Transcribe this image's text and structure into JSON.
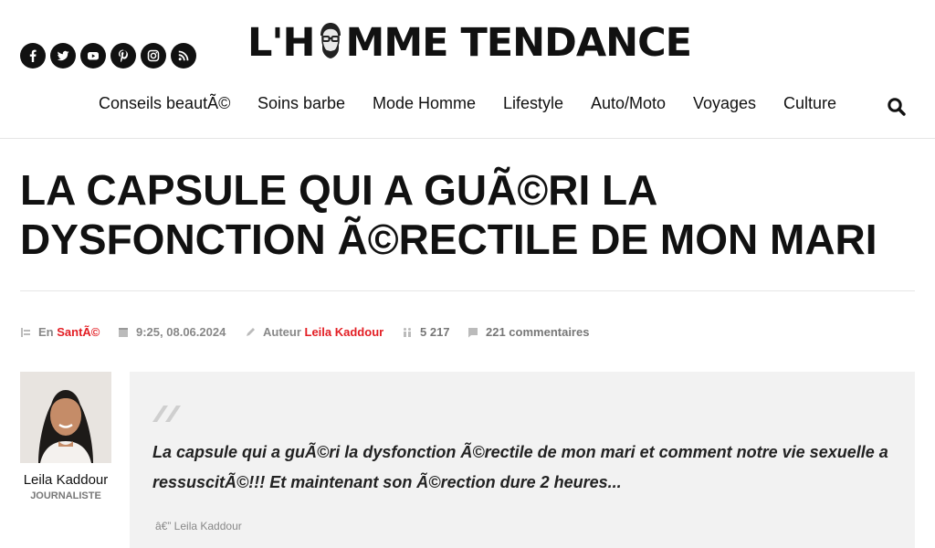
{
  "header": {
    "logo_text": "L'HOMME TENDANCE",
    "logo_left": "L'H",
    "logo_right": "MME TENDANCE"
  },
  "social": [
    {
      "icon": "facebook-icon"
    },
    {
      "icon": "twitter-icon"
    },
    {
      "icon": "youtube-icon"
    },
    {
      "icon": "pinterest-icon"
    },
    {
      "icon": "instagram-icon"
    },
    {
      "icon": "rss-icon"
    }
  ],
  "nav": {
    "items": [
      {
        "label": "Conseils beautÃ©"
      },
      {
        "label": "Soins barbe"
      },
      {
        "label": "Mode Homme"
      },
      {
        "label": "Lifestyle"
      },
      {
        "label": "Auto/Moto"
      },
      {
        "label": "Voyages"
      },
      {
        "label": "Culture"
      }
    ],
    "search_icon": "search-icon"
  },
  "article": {
    "title": "LA CAPSULE QUI A GUÃ©RI LA DYSFONCTION Ã©RECTILE DE MON MARI",
    "meta": {
      "category_prefix": "En",
      "category": "SantÃ©",
      "datetime": "9:25, 08.06.2024",
      "author_prefix": "Auteur",
      "author": "Leila Kaddour",
      "views": "5 217",
      "comments": "221 commentaires"
    }
  },
  "author_box": {
    "name": "Leila Kaddour",
    "role": "JOURNALISTE"
  },
  "quote": {
    "text": "La capsule qui a guÃ©ri la dysfonction Ã©rectile de mon mari et comment notre vie sexuelle a ressuscitÃ©!!! Et maintenant son Ã©rection dure 2 heures...",
    "signature": "â€” Leila Kaddour"
  },
  "colors": {
    "accent": "#e31e24",
    "text": "#111111",
    "muted": "#888888",
    "quote_bg": "#f2f2f2"
  }
}
